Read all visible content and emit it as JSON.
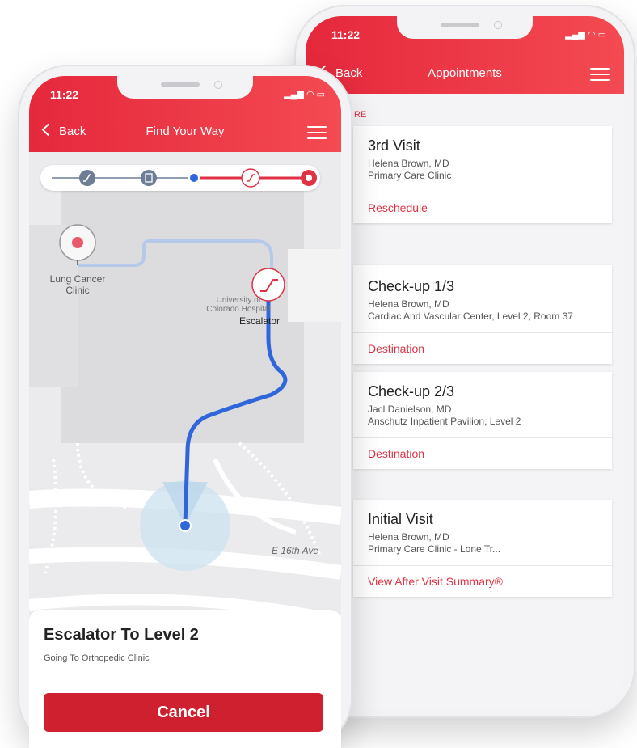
{
  "appointments_screen": {
    "status": {
      "time": "11:22"
    },
    "nav": {
      "back": "Back",
      "title": "Appointments"
    },
    "section_label": "RE",
    "cards": [
      {
        "title": "3rd Visit",
        "doctor": "Helena Brown, MD",
        "location": "Primary Care Clinic",
        "action": "Reschedule"
      },
      {
        "title": "Check-up 1/3",
        "doctor": "Helena Brown, MD",
        "location": "Cardiac And Vascular Center, Level 2, Room 37",
        "action": "Destination"
      },
      {
        "title": "Check-up 2/3",
        "doctor": "Jacl Danielson, MD",
        "location": "Anschutz Inpatient Pavilion, Level 2",
        "action": "Destination"
      },
      {
        "title": "Initial Visit",
        "doctor": "Helena Brown, MD",
        "location": "Primary Care Clinic - Lone Tr...",
        "action": "View After Visit Summary®"
      }
    ]
  },
  "wayfinding_screen": {
    "status": {
      "time": "11:22"
    },
    "nav": {
      "back": "Back",
      "title": "Find Your Way"
    },
    "map": {
      "labels": {
        "clinic": "Lung Cancer Clinic",
        "hospital": "University of Colorado Hospital",
        "escalator": "Escalator",
        "street": "E 16th Ave"
      }
    },
    "progress_steps": [
      "escalator-icon",
      "elevator-icon",
      "current-position",
      "escalator-icon",
      "destination-icon"
    ],
    "bottom_sheet": {
      "title": "Escalator To Level 2",
      "subtitle": "Going To Orthopedic Clinic",
      "cancel_label": "Cancel"
    }
  },
  "colors": {
    "accent": "#e5283c",
    "route_blue": "#3367d6",
    "button_red": "#cf2030"
  }
}
